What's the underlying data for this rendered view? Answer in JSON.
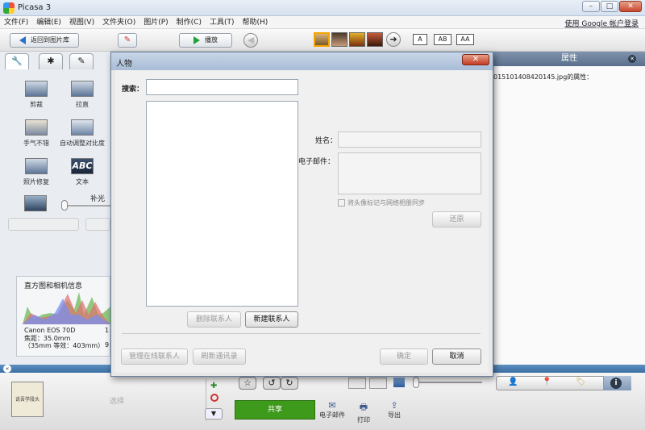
{
  "window": {
    "title": "Picasa 3",
    "minimize": "–",
    "maximize": "□",
    "close": "✕"
  },
  "menu": [
    "文件(F)",
    "编辑(E)",
    "视图(V)",
    "文件夹(O)",
    "图片(P)",
    "制作(C)",
    "工具(T)",
    "帮助(H)"
  ],
  "google_login": "使用 Google 帐户登录",
  "toolbar": {
    "back_label": "返回到图片库",
    "play_label": "播放",
    "caption_modes": [
      "A",
      "AB",
      "AA"
    ]
  },
  "left_panel": {
    "tabs": [
      {
        "icon": "wrench-icon",
        "glyph": "🔧"
      },
      {
        "icon": "sun-icon",
        "glyph": "✱"
      },
      {
        "icon": "brush-icon",
        "glyph": "✎"
      }
    ],
    "tools": [
      "剪裁",
      "拉直",
      "手气不错",
      "自动调整对比度",
      "照片修复",
      "文本"
    ],
    "fill_light_label": "补光",
    "fill_light_level": 0,
    "histogram_title": "直方图和相机信息",
    "camera": "Canon EOS 70D",
    "focal": "焦距：35.0mm",
    "equiv": "（35mm 等效：403mm）",
    "extra_1": "1",
    "extra_2": "9"
  },
  "right_panel": {
    "header": "属性",
    "close": "✕",
    "filename_text": "015101408420145.jpg的属性："
  },
  "bottom": {
    "select_label": "选择",
    "share_label": "共享",
    "email_label": "电子邮件",
    "print_label": "打印",
    "export_label": "导出",
    "tray_thumb_text": "说吾学段头"
  },
  "dialog": {
    "title": "人物",
    "close": "✕",
    "search_label": "搜索：",
    "search_value": "",
    "name_label": "姓名：",
    "email_label": "电子邮件：",
    "sync_label": "将头像标记与网络相册同步",
    "sync_checked": false,
    "restore_button": "还原",
    "delete_contact": "删除联系人",
    "new_contact": "新建联系人",
    "manage_online": "管理在线联系人",
    "refresh_contacts": "刷新通讯录",
    "ok": "确定",
    "cancel": "取消"
  },
  "colors": {
    "share_green": "#3d9a1a",
    "accent_blue": "#3b6fa3"
  }
}
